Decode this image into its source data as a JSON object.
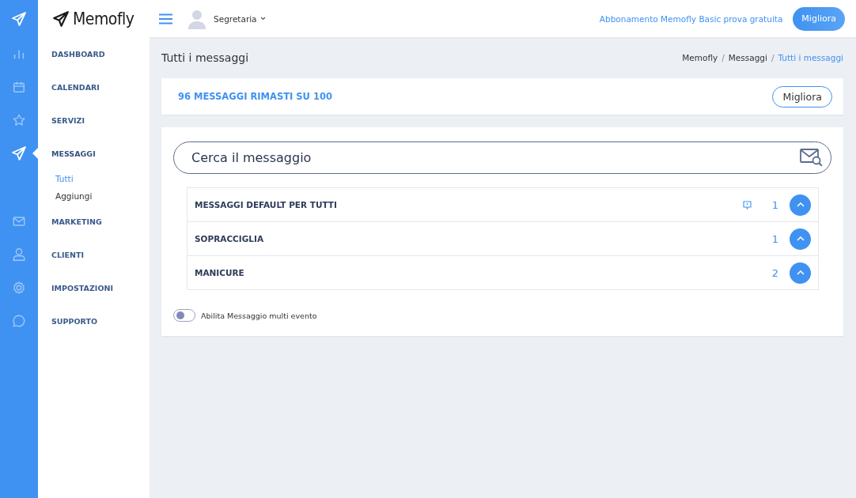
{
  "brand": {
    "name": "Memofly"
  },
  "nav": [
    {
      "label": "DASHBOARD",
      "selected": false
    },
    {
      "label": "CALENDARI",
      "selected": false
    },
    {
      "label": "SERVIZI",
      "selected": false
    },
    {
      "label": "MESSAGGI",
      "selected": true,
      "children": [
        {
          "label": "Tutti",
          "selected": true
        },
        {
          "label": "Aggiungi",
          "selected": false
        }
      ]
    },
    {
      "label": "MARKETING",
      "selected": false
    },
    {
      "label": "CLIENTI",
      "selected": false
    },
    {
      "label": "IMPOSTAZIONI",
      "selected": false
    },
    {
      "label": "SUPPORTO",
      "selected": false
    }
  ],
  "topbar": {
    "user": "Segretaria",
    "subscription_link": "Abbonamento Memofly Basic prova gratuita",
    "upgrade_button": "Migliora"
  },
  "page": {
    "title": "Tutti i messaggi",
    "breadcrumb": [
      {
        "kind": "link",
        "text": "Memofly"
      },
      {
        "kind": "separator",
        "text": "/"
      },
      {
        "kind": "link",
        "text": "Messaggi"
      },
      {
        "kind": "separator",
        "text": "/"
      },
      {
        "kind": "current",
        "text": "Tutti i messaggi"
      }
    ]
  },
  "quota": {
    "text": "96 MESSAGGI RIMASTI SU 100",
    "button": "Migliora"
  },
  "search": {
    "placeholder": "Cerca il messaggio"
  },
  "groups": [
    {
      "name": "MESSAGGI DEFAULT PER TUTTI",
      "count": "1",
      "has_note": true
    },
    {
      "name": "SOPRACCIGLIA",
      "count": "1",
      "has_note": false
    },
    {
      "name": "MANICURE",
      "count": "2",
      "has_note": false
    }
  ],
  "toggle": {
    "label": "Abilita Messaggio multi evento",
    "on": false
  }
}
